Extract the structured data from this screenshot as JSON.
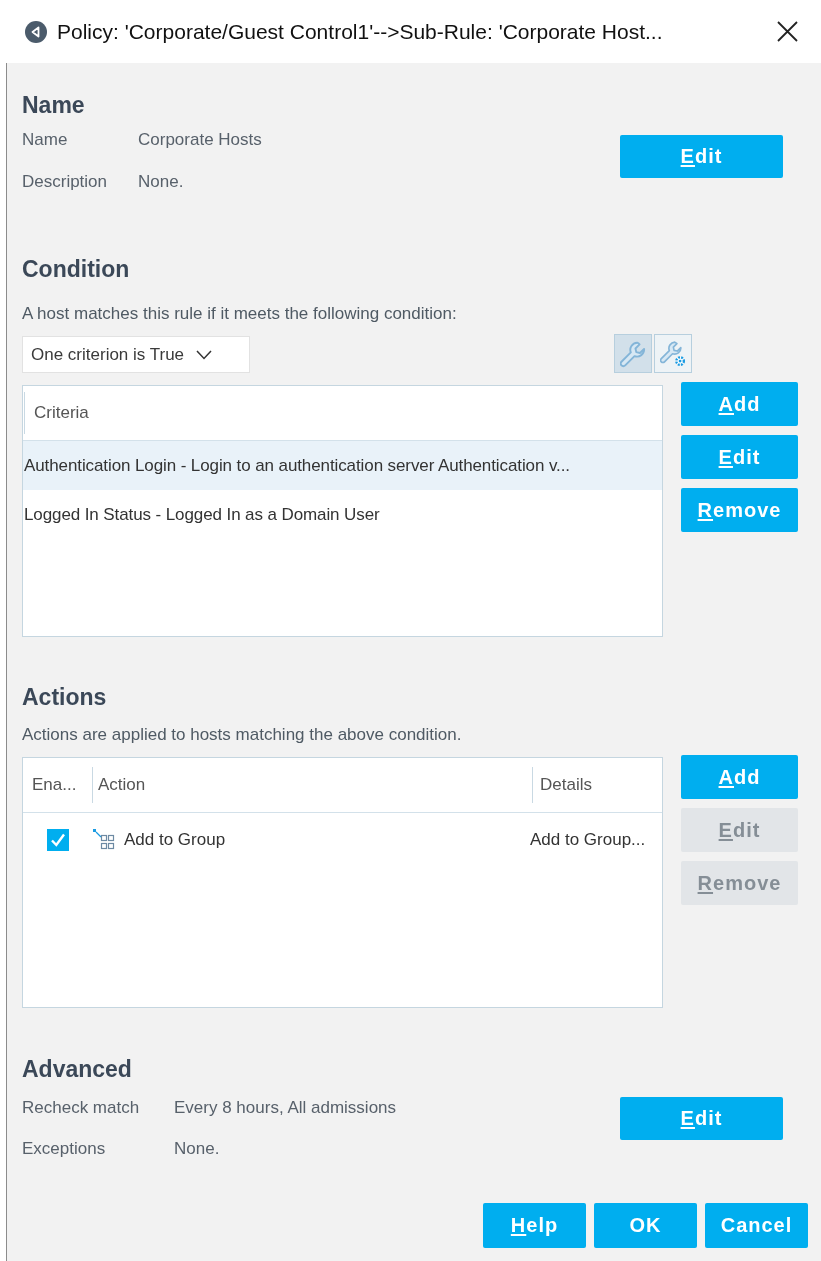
{
  "window": {
    "title": "Policy: 'Corporate/Guest Control1'-->Sub-Rule: 'Corporate Host..."
  },
  "name_section": {
    "heading": "Name",
    "fields": [
      {
        "label": "Name",
        "value": "Corporate Hosts"
      },
      {
        "label": "Description",
        "value": "None."
      }
    ],
    "buttons": [
      {
        "label": "Edit",
        "mnemonic": true,
        "disabled": false
      }
    ]
  },
  "condition": {
    "heading": "Condition",
    "description": "A host matches this rule if it meets the following condition:",
    "match_dropdown": {
      "value": "One criterion is True"
    },
    "view_toggles": [
      {
        "kind": "wrench",
        "selected": true
      },
      {
        "kind": "wrench-gear",
        "selected": false
      }
    ],
    "table": {
      "columns": [
        "Criteria"
      ],
      "rows": [
        {
          "criteria": "Authentication Login - Login to an authentication server Authentication v...",
          "selected": true
        },
        {
          "criteria": "Logged In Status - Logged In as a Domain User",
          "selected": false
        }
      ]
    },
    "buttons": [
      {
        "label": "Add",
        "mnemonic": true,
        "disabled": false
      },
      {
        "label": "Edit",
        "mnemonic": true,
        "disabled": false
      },
      {
        "label": "Remove",
        "mnemonic": true,
        "disabled": false
      }
    ]
  },
  "actions": {
    "heading": "Actions",
    "description": "Actions are applied to hosts matching the above condition.",
    "table": {
      "columns": [
        "Ena...",
        "Action",
        "Details"
      ],
      "rows": [
        {
          "enabled": true,
          "action": "Add to Group",
          "details": "Add to Group...",
          "selected": false
        }
      ]
    },
    "buttons": [
      {
        "label": "Add",
        "mnemonic": true,
        "disabled": false
      },
      {
        "label": "Edit",
        "mnemonic": true,
        "disabled": true
      },
      {
        "label": "Remove",
        "mnemonic": true,
        "disabled": true
      }
    ]
  },
  "advanced": {
    "heading": "Advanced",
    "fields": [
      {
        "label": "Recheck match",
        "value": "Every 8 hours, All admissions"
      },
      {
        "label": "Exceptions",
        "value": "None."
      }
    ],
    "buttons": [
      {
        "label": "Edit",
        "mnemonic": true,
        "disabled": false
      }
    ]
  },
  "footer_buttons": [
    {
      "label": "Help",
      "mnemonic": true,
      "disabled": false
    },
    {
      "label": "OK",
      "mnemonic": false,
      "disabled": false
    },
    {
      "label": "Cancel",
      "mnemonic": false,
      "disabled": false
    }
  ]
}
